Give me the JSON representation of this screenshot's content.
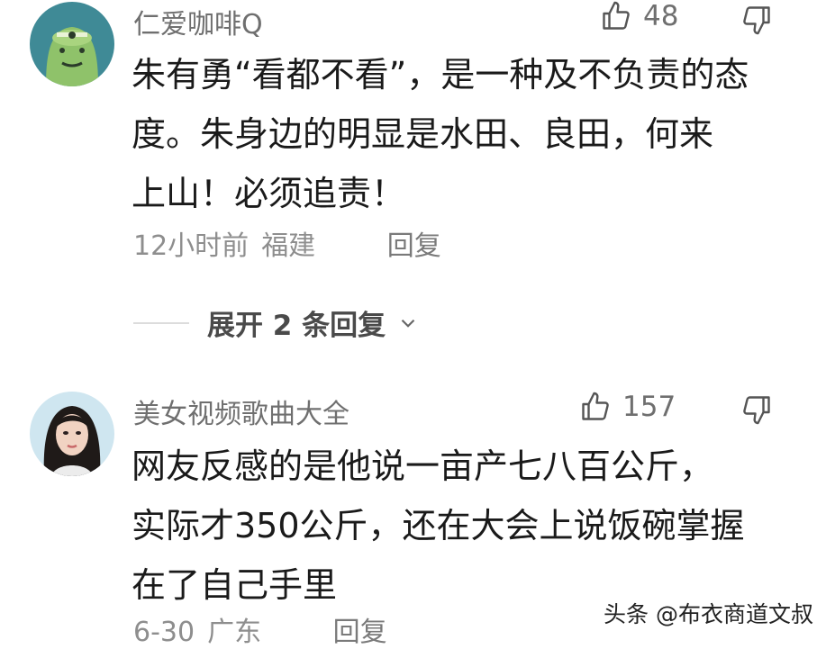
{
  "comments": [
    {
      "username": "仁爱咖啡Q",
      "likes": "48",
      "lines": [
        "朱有勇“看都不看”，是一种及不负责的态",
        "度。朱身边的明显是水田、良田，何来",
        "上山！必须追责！"
      ],
      "time": "12小时前",
      "location": "福建",
      "reply_label": "回复",
      "avatar_icon": "green-cartoon-avatar"
    },
    {
      "username": "美女视频歌曲大全",
      "likes": "157",
      "lines": [
        "网友反感的是他说一亩产七八百公斤，",
        "实际才350公斤，还在大会上说饭碗掌握",
        "在了自己手里"
      ],
      "time": "6-30",
      "location": "广东",
      "reply_label": "回复",
      "avatar_icon": "woman-photo-avatar"
    }
  ],
  "expand_replies": {
    "label": "展开 2 条回复",
    "icon": "chevron-down-icon"
  },
  "watermark": "头条 @布衣商道文叔",
  "colors": {
    "text": "#1a1a1a",
    "meta": "#8e8e8e",
    "username": "#6f6f6f",
    "background": "#ffffff"
  }
}
